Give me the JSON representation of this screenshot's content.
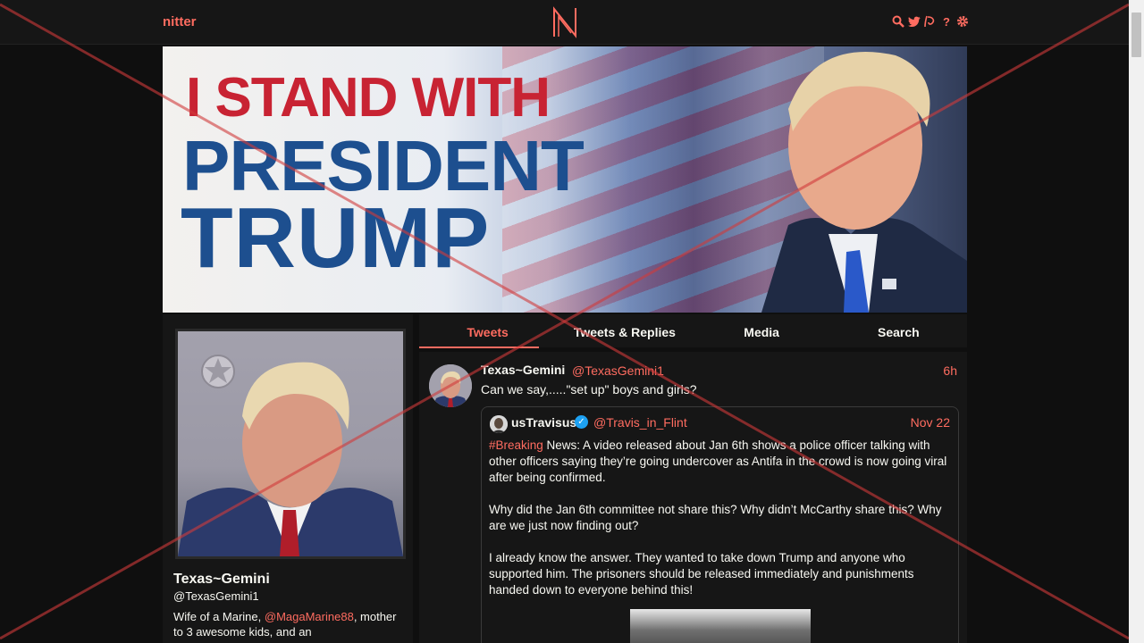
{
  "nav": {
    "brand": "nitter",
    "logo_letter": "N",
    "icons": [
      "search-icon",
      "twitter-icon",
      "rss-icon",
      "help-icon",
      "settings-icon"
    ],
    "help_glyph": "?",
    "accent_color": "#ff6c60"
  },
  "banner": {
    "line1": "I STAND WITH",
    "line2": "PRESIDENT",
    "line3": "TRUMP"
  },
  "profile": {
    "name": "Texas~Gemini",
    "handle": "@TexasGemini1",
    "bio_prefix": "Wife of a Marine,",
    "bio_mention": "@MagaMarine88",
    "bio_suffix": ", mother to 3 awesome kids, and an"
  },
  "tabs": [
    {
      "label": "Tweets",
      "active": true
    },
    {
      "label": "Tweets & Replies",
      "active": false
    },
    {
      "label": "Media",
      "active": false
    },
    {
      "label": "Search",
      "active": false
    }
  ],
  "tweet": {
    "name": "Texas~Gemini",
    "handle": "@TexasGemini1",
    "date": "6h",
    "text": "Can we say,.....\"set up\" boys and girls?",
    "quote": {
      "name": "usTravisus",
      "verified_glyph": "✓",
      "handle": "@Travis_in_Flint",
      "date": "Nov 22",
      "hashtag": "#Breaking",
      "para1": " News: A video released about Jan 6th shows a police officer talking with other officers saying they’re going undercover as Antifa in the crowd is now going viral after being confirmed.",
      "para2": "Why did the Jan 6th committee not share this?  Why didn’t McCarthy share this?  Why are we just now finding out?",
      "para3": "I already know the answer.  They wanted to take down Trump and anyone who supported him.  The prisoners should be released immediately and punishments handed down to everyone behind this!"
    }
  }
}
